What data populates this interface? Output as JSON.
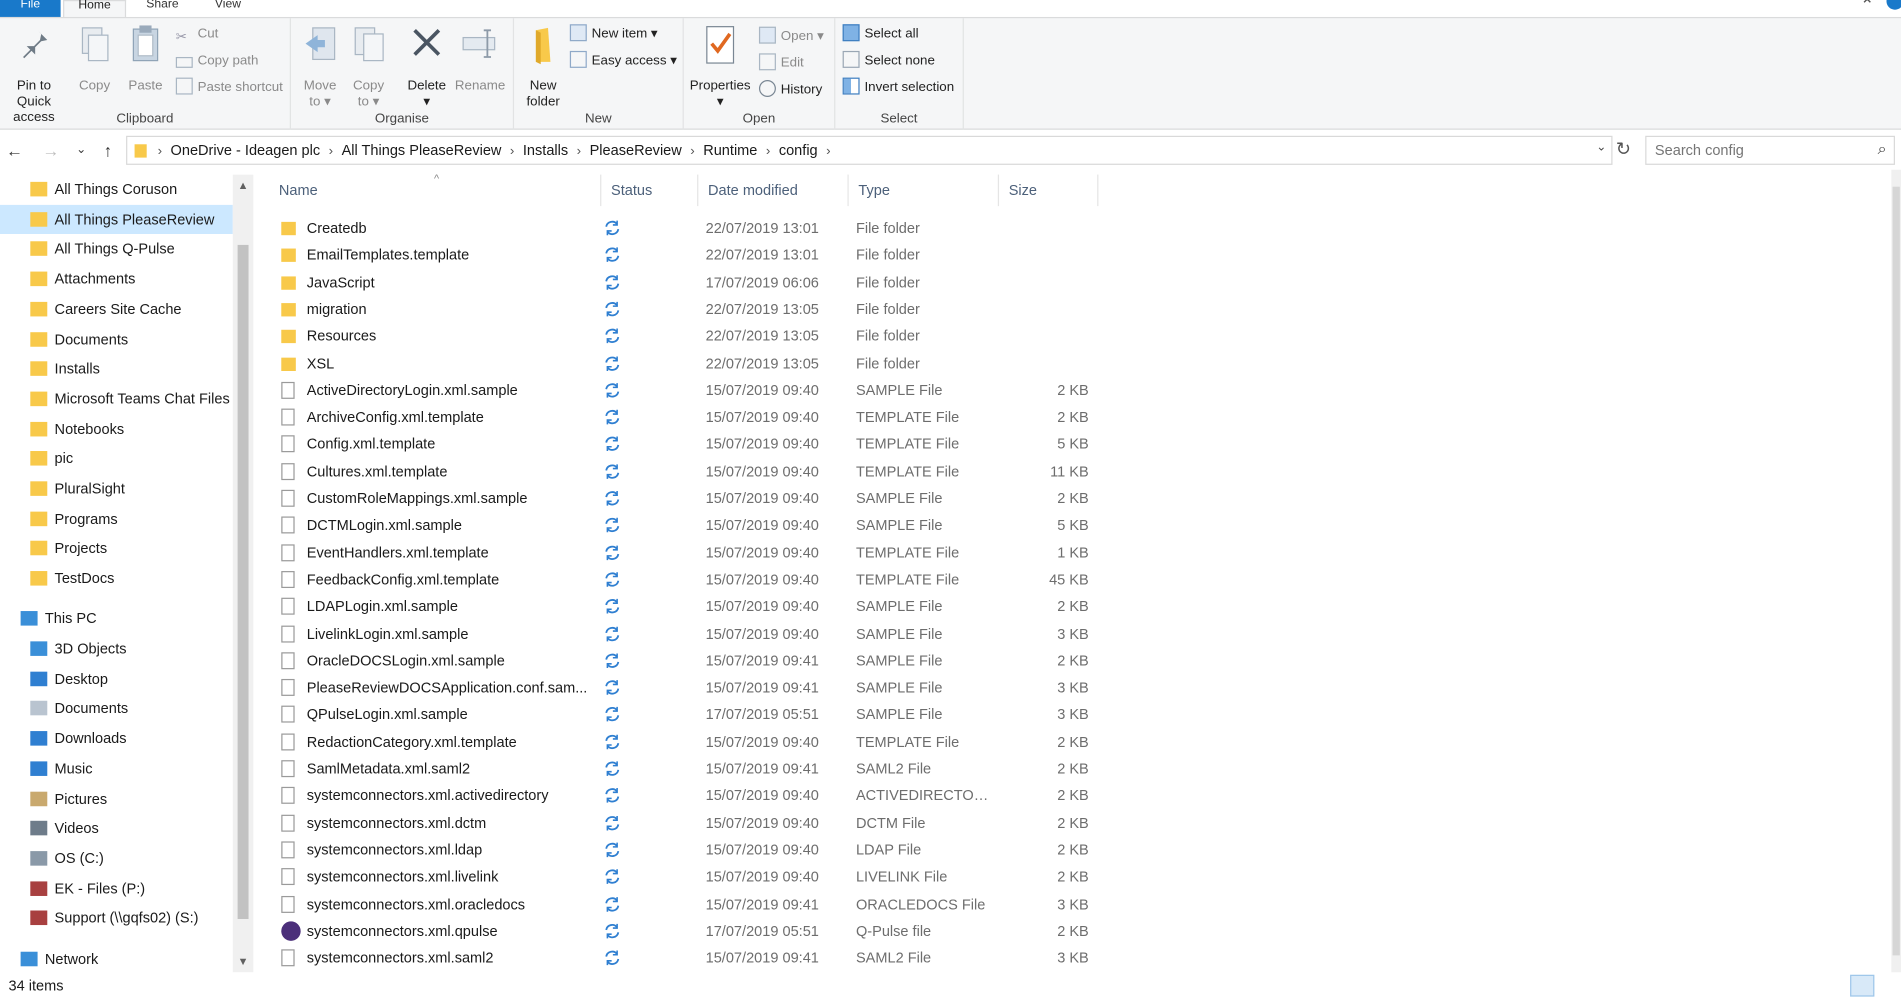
{
  "ribbon_tabs": [
    "File",
    "Home",
    "Share",
    "View"
  ],
  "ribbon": {
    "clipboard": {
      "label": "Clipboard",
      "pin_to_quick_access": "Pin to Quick\naccess",
      "copy": "Copy",
      "paste": "Paste",
      "cut": "Cut",
      "copy_path": "Copy path",
      "paste_shortcut": "Paste shortcut"
    },
    "organise": {
      "label": "Organise",
      "move_to": "Move\nto ▾",
      "copy_to": "Copy\nto ▾",
      "delete": "Delete\n▾",
      "rename": "Rename"
    },
    "new": {
      "label": "New",
      "new_folder": "New\nfolder",
      "new_item": "New item ▾",
      "easy_access": "Easy access ▾"
    },
    "open": {
      "label": "Open",
      "properties": "Properties\n▾",
      "open": "Open ▾",
      "edit": "Edit",
      "history": "History"
    },
    "select": {
      "label": "Select",
      "select_all": "Select all",
      "select_none": "Select none",
      "invert_selection": "Invert selection"
    }
  },
  "address": {
    "breadcrumbs": [
      "OneDrive - Ideagen plc",
      "All Things PleaseReview",
      "Installs",
      "PleaseReview",
      "Runtime",
      "config"
    ],
    "search_placeholder": "Search config"
  },
  "nav_pane": {
    "quick_items": [
      {
        "label": "All Things Coruson",
        "icon": "folder-icon"
      },
      {
        "label": "All Things PleaseReview",
        "icon": "folder-icon",
        "selected": true
      },
      {
        "label": "All Things Q-Pulse",
        "icon": "folder-icon"
      },
      {
        "label": "Attachments",
        "icon": "folder-icon"
      },
      {
        "label": "Careers Site Cache",
        "icon": "folder-icon"
      },
      {
        "label": "Documents",
        "icon": "folder-icon"
      },
      {
        "label": "Installs",
        "icon": "folder-icon"
      },
      {
        "label": "Microsoft Teams Chat Files",
        "icon": "folder-icon"
      },
      {
        "label": "Notebooks",
        "icon": "folder-icon"
      },
      {
        "label": "pic",
        "icon": "folder-icon"
      },
      {
        "label": "PluralSight",
        "icon": "folder-icon"
      },
      {
        "label": "Programs",
        "icon": "folder-icon"
      },
      {
        "label": "Projects",
        "icon": "folder-icon"
      },
      {
        "label": "TestDocs",
        "icon": "folder-icon"
      }
    ],
    "this_pc": "This PC",
    "pc_items": [
      {
        "label": "3D Objects",
        "icon": "3d-objects-icon"
      },
      {
        "label": "Desktop",
        "icon": "desktop-icon"
      },
      {
        "label": "Documents",
        "icon": "documents-icon"
      },
      {
        "label": "Downloads",
        "icon": "downloads-icon"
      },
      {
        "label": "Music",
        "icon": "music-icon"
      },
      {
        "label": "Pictures",
        "icon": "pictures-icon"
      },
      {
        "label": "Videos",
        "icon": "videos-icon"
      },
      {
        "label": "OS (C:)",
        "icon": "drive-icon"
      },
      {
        "label": "EK - Files (P:)",
        "icon": "network-drive-icon"
      },
      {
        "label": "Support (\\\\gqfs02) (S:)",
        "icon": "network-drive-icon"
      }
    ],
    "network": "Network"
  },
  "columns": [
    "Name",
    "Status",
    "Date modified",
    "Type",
    "Size"
  ],
  "files": [
    {
      "name": "Createdb",
      "date": "22/07/2019 13:01",
      "type": "File folder",
      "size": "",
      "kind": "folder"
    },
    {
      "name": "EmailTemplates.template",
      "date": "22/07/2019 13:01",
      "type": "File folder",
      "size": "",
      "kind": "folder"
    },
    {
      "name": "JavaScript",
      "date": "17/07/2019 06:06",
      "type": "File folder",
      "size": "",
      "kind": "folder"
    },
    {
      "name": "migration",
      "date": "22/07/2019 13:05",
      "type": "File folder",
      "size": "",
      "kind": "folder"
    },
    {
      "name": "Resources",
      "date": "22/07/2019 13:05",
      "type": "File folder",
      "size": "",
      "kind": "folder"
    },
    {
      "name": "XSL",
      "date": "22/07/2019 13:05",
      "type": "File folder",
      "size": "",
      "kind": "folder"
    },
    {
      "name": "ActiveDirectoryLogin.xml.sample",
      "date": "15/07/2019 09:40",
      "type": "SAMPLE File",
      "size": "2 KB",
      "kind": "file"
    },
    {
      "name": "ArchiveConfig.xml.template",
      "date": "15/07/2019 09:40",
      "type": "TEMPLATE File",
      "size": "2 KB",
      "kind": "file"
    },
    {
      "name": "Config.xml.template",
      "date": "15/07/2019 09:40",
      "type": "TEMPLATE File",
      "size": "5 KB",
      "kind": "file"
    },
    {
      "name": "Cultures.xml.template",
      "date": "15/07/2019 09:40",
      "type": "TEMPLATE File",
      "size": "11 KB",
      "kind": "file"
    },
    {
      "name": "CustomRoleMappings.xml.sample",
      "date": "15/07/2019 09:40",
      "type": "SAMPLE File",
      "size": "2 KB",
      "kind": "file"
    },
    {
      "name": "DCTMLogin.xml.sample",
      "date": "15/07/2019 09:40",
      "type": "SAMPLE File",
      "size": "5 KB",
      "kind": "file"
    },
    {
      "name": "EventHandlers.xml.template",
      "date": "15/07/2019 09:40",
      "type": "TEMPLATE File",
      "size": "1 KB",
      "kind": "file"
    },
    {
      "name": "FeedbackConfig.xml.template",
      "date": "15/07/2019 09:40",
      "type": "TEMPLATE File",
      "size": "45 KB",
      "kind": "file"
    },
    {
      "name": "LDAPLogin.xml.sample",
      "date": "15/07/2019 09:40",
      "type": "SAMPLE File",
      "size": "2 KB",
      "kind": "file"
    },
    {
      "name": "LivelinkLogin.xml.sample",
      "date": "15/07/2019 09:40",
      "type": "SAMPLE File",
      "size": "3 KB",
      "kind": "file"
    },
    {
      "name": "OracleDOCSLogin.xml.sample",
      "date": "15/07/2019 09:41",
      "type": "SAMPLE File",
      "size": "2 KB",
      "kind": "file"
    },
    {
      "name": "PleaseReviewDOCSApplication.conf.sam...",
      "date": "15/07/2019 09:41",
      "type": "SAMPLE File",
      "size": "3 KB",
      "kind": "file"
    },
    {
      "name": "QPulseLogin.xml.sample",
      "date": "17/07/2019 05:51",
      "type": "SAMPLE File",
      "size": "3 KB",
      "kind": "file"
    },
    {
      "name": "RedactionCategory.xml.template",
      "date": "15/07/2019 09:40",
      "type": "TEMPLATE File",
      "size": "2 KB",
      "kind": "file"
    },
    {
      "name": "SamlMetadata.xml.saml2",
      "date": "15/07/2019 09:41",
      "type": "SAML2 File",
      "size": "2 KB",
      "kind": "file"
    },
    {
      "name": "systemconnectors.xml.activedirectory",
      "date": "15/07/2019 09:40",
      "type": "ACTIVEDIRECTORY...",
      "size": "2 KB",
      "kind": "file"
    },
    {
      "name": "systemconnectors.xml.dctm",
      "date": "15/07/2019 09:40",
      "type": "DCTM File",
      "size": "2 KB",
      "kind": "file"
    },
    {
      "name": "systemconnectors.xml.ldap",
      "date": "15/07/2019 09:40",
      "type": "LDAP File",
      "size": "2 KB",
      "kind": "file"
    },
    {
      "name": "systemconnectors.xml.livelink",
      "date": "15/07/2019 09:40",
      "type": "LIVELINK File",
      "size": "2 KB",
      "kind": "file"
    },
    {
      "name": "systemconnectors.xml.oracledocs",
      "date": "15/07/2019 09:41",
      "type": "ORACLEDOCS File",
      "size": "3 KB",
      "kind": "file"
    },
    {
      "name": "systemconnectors.xml.qpulse",
      "date": "17/07/2019 05:51",
      "type": "Q-Pulse file",
      "size": "2 KB",
      "kind": "qpulse"
    },
    {
      "name": "systemconnectors.xml.saml2",
      "date": "15/07/2019 09:41",
      "type": "SAML2 File",
      "size": "3 KB",
      "kind": "file"
    }
  ],
  "status_bar": {
    "item_count": "34 items"
  },
  "colors": {
    "accent": "#1979ca",
    "selected": "#cce8ff",
    "folder": "#f8c94a",
    "sync": "#2f7fd1"
  }
}
